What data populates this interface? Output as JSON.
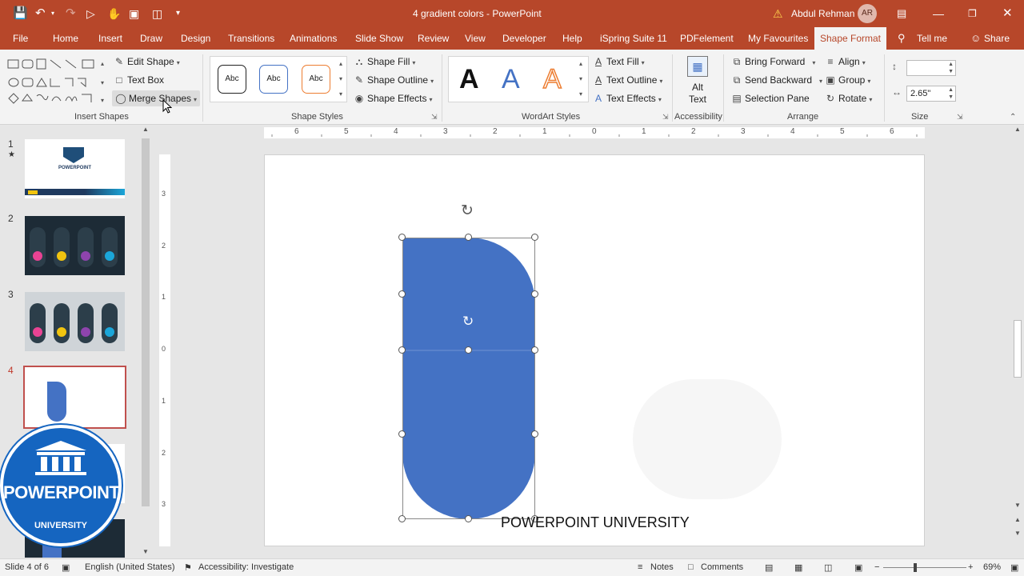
{
  "app": {
    "title": "4 gradient colors - PowerPoint",
    "user_name": "Abdul Rehman",
    "user_initials": "AR"
  },
  "tabs": [
    {
      "label": "File"
    },
    {
      "label": "Home"
    },
    {
      "label": "Insert"
    },
    {
      "label": "Draw"
    },
    {
      "label": "Design"
    },
    {
      "label": "Transitions"
    },
    {
      "label": "Animations"
    },
    {
      "label": "Slide Show"
    },
    {
      "label": "Review"
    },
    {
      "label": "View"
    },
    {
      "label": "Developer"
    },
    {
      "label": "Help"
    },
    {
      "label": "iSpring Suite 11"
    },
    {
      "label": "PDFelement"
    },
    {
      "label": "My Favourites"
    },
    {
      "label": "Shape Format"
    },
    {
      "label": "Tell me"
    },
    {
      "label": "Share"
    }
  ],
  "ribbon": {
    "insert_shapes": {
      "edit_shape": "Edit Shape",
      "text_box": "Text Box",
      "merge_shapes": "Merge Shapes",
      "label": "Insert Shapes"
    },
    "shape_styles": {
      "preset_text": "Abc",
      "shape_fill": "Shape Fill",
      "shape_outline": "Shape Outline",
      "shape_effects": "Shape Effects",
      "label": "Shape Styles"
    },
    "wordart": {
      "letter": "A",
      "text_fill": "Text Fill",
      "text_outline": "Text Outline",
      "text_effects": "Text Effects",
      "label": "WordArt Styles"
    },
    "accessibility": {
      "alt_text_line1": "Alt",
      "alt_text_line2": "Text",
      "label": "Accessibility"
    },
    "arrange": {
      "bring_forward": "Bring Forward",
      "send_backward": "Send Backward",
      "selection_pane": "Selection Pane",
      "align": "Align",
      "group": "Group",
      "rotate": "Rotate",
      "label": "Arrange"
    },
    "size": {
      "height": "",
      "width": "2.65\"",
      "label": "Size"
    }
  },
  "slides": [
    {
      "number": "1",
      "logo_title": "POWERPOINT"
    },
    {
      "number": "2"
    },
    {
      "number": "3"
    },
    {
      "number": "4"
    }
  ],
  "slide_content": {
    "caption": "POWERPOINT UNIVERSITY",
    "shape_color": "#4472c4"
  },
  "overlay_logo": {
    "line1": "POWERPOINT",
    "line2": "UNIVERSITY"
  },
  "ruler": {
    "h_ticks": [
      "6",
      "5",
      "4",
      "3",
      "2",
      "1",
      "0",
      "1",
      "2",
      "3",
      "4",
      "5",
      "6"
    ],
    "v_ticks": [
      "3",
      "2",
      "1",
      "0",
      "1",
      "2",
      "3"
    ]
  },
  "status": {
    "slide_info": "Slide 4 of 6",
    "language": "English (United States)",
    "accessibility": "Accessibility: Investigate",
    "notes": "Notes",
    "comments": "Comments",
    "zoom": "69%"
  },
  "colors": {
    "accent": "#b7472a",
    "shape": "#4472c4"
  }
}
